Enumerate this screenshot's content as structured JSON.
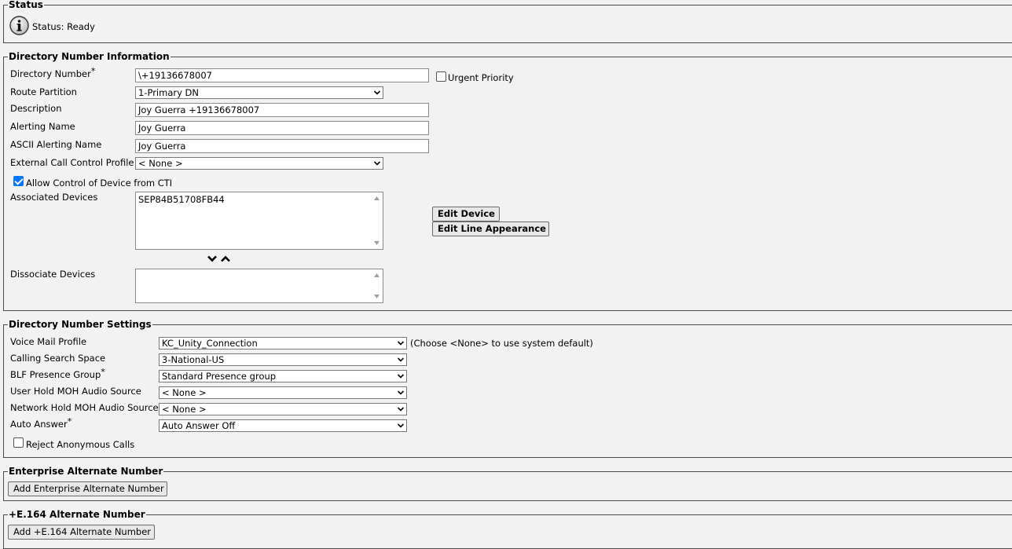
{
  "status": {
    "legend": "Status",
    "text": "Status: Ready",
    "icon": "info-icon"
  },
  "dn_info": {
    "legend": "Directory Number Information",
    "directory_number": {
      "label": "Directory Number",
      "required": "*",
      "value": "\\+19136678007"
    },
    "urgent_priority": {
      "label": "Urgent Priority",
      "checked": false
    },
    "route_partition": {
      "label": "Route Partition",
      "value": "1-Primary DN"
    },
    "description": {
      "label": "Description",
      "value": "Joy Guerra +19136678007"
    },
    "alerting_name": {
      "label": "Alerting Name",
      "value": "Joy Guerra"
    },
    "ascii_alerting_name": {
      "label": "ASCII Alerting Name",
      "value": "Joy Guerra"
    },
    "external_call_control": {
      "label": "External Call Control Profile",
      "value": "< None >"
    },
    "allow_cti": {
      "label": "Allow Control of Device from CTI",
      "checked": true
    },
    "associated_devices": {
      "label": "Associated Devices",
      "items": [
        "SEP84B51708FB44"
      ]
    },
    "edit_device_label": "Edit Device",
    "edit_line_appearance_label": "Edit Line Appearance",
    "dissociate_devices": {
      "label": "Dissociate Devices",
      "items": []
    }
  },
  "dn_settings": {
    "legend": "Directory Number Settings",
    "voice_mail_profile": {
      "label": "Voice Mail Profile",
      "value": "KC_Unity_Connection",
      "hint": "(Choose <None> to use system default)"
    },
    "calling_search_space": {
      "label": "Calling Search Space",
      "value": "3-National-US"
    },
    "blf_presence_group": {
      "label": "BLF Presence Group",
      "required": "*",
      "value": "Standard Presence group"
    },
    "user_hold_moh": {
      "label": "User Hold MOH Audio Source",
      "value": "< None >"
    },
    "network_hold_moh": {
      "label": "Network Hold MOH Audio Source",
      "value": "< None >"
    },
    "auto_answer": {
      "label": "Auto Answer",
      "required": "*",
      "value": "Auto Answer Off"
    },
    "reject_anonymous": {
      "label": "Reject Anonymous Calls",
      "checked": false
    }
  },
  "enterprise_alt": {
    "legend": "Enterprise Alternate Number",
    "button_label": "Add Enterprise Alternate Number"
  },
  "e164_alt": {
    "legend": "+E.164 Alternate Number",
    "button_label": "Add +E.164 Alternate Number"
  }
}
